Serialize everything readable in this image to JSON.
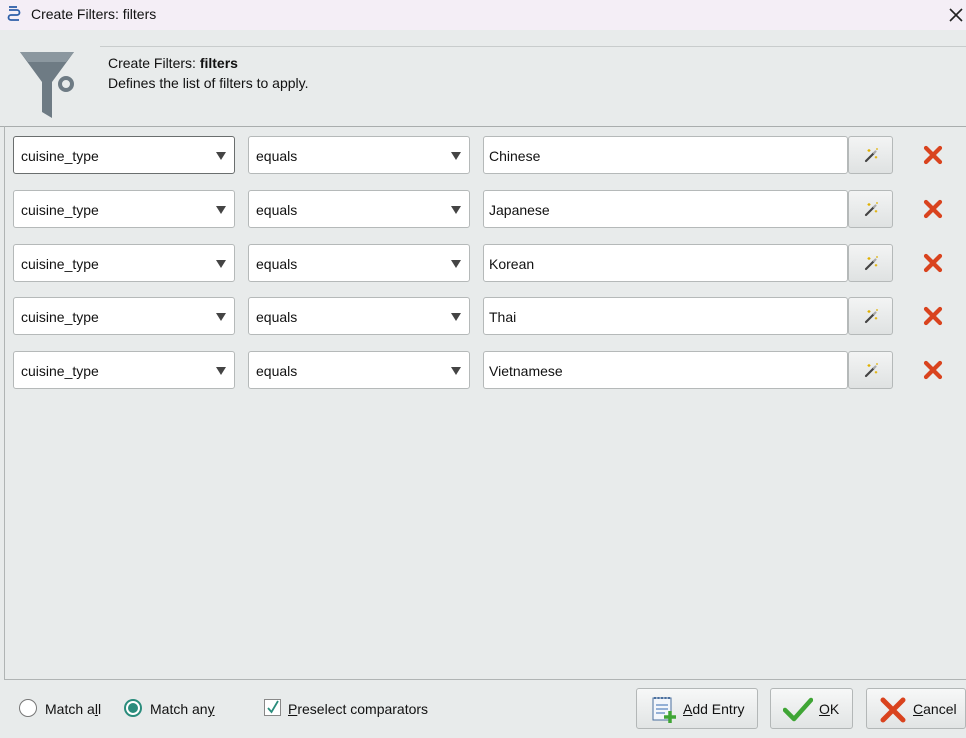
{
  "window": {
    "title": "Create Filters: filters",
    "close_icon": "close-icon"
  },
  "header": {
    "title_prefix": "Create Filters: ",
    "title_bold": "filters",
    "description": "Defines the list of filters to apply.",
    "icon": "funnel-icon"
  },
  "filters": [
    {
      "field": "cuisine_type",
      "comparator": "equals",
      "value": "Chinese"
    },
    {
      "field": "cuisine_type",
      "comparator": "equals",
      "value": "Japanese"
    },
    {
      "field": "cuisine_type",
      "comparator": "equals",
      "value": "Korean"
    },
    {
      "field": "cuisine_type",
      "comparator": "equals",
      "value": "Thai"
    },
    {
      "field": "cuisine_type",
      "comparator": "equals",
      "value": "Vietnamese"
    }
  ],
  "footer": {
    "match_all": {
      "pre": "Match a",
      "ul": "l",
      "post": "l",
      "selected": false
    },
    "match_any": {
      "pre": "Match an",
      "ul": "y",
      "post": "",
      "selected": true
    },
    "preselect": {
      "ul": "P",
      "post": "reselect comparators",
      "checked": true
    },
    "add_entry": {
      "ul": "A",
      "post": "dd Entry"
    },
    "ok": {
      "ul": "O",
      "post": "K"
    },
    "cancel": {
      "ul": "C",
      "post": "ancel"
    }
  },
  "colors": {
    "accent": "#2a8c7c",
    "delete": "#d9431e",
    "ok_check": "#3fa535"
  }
}
